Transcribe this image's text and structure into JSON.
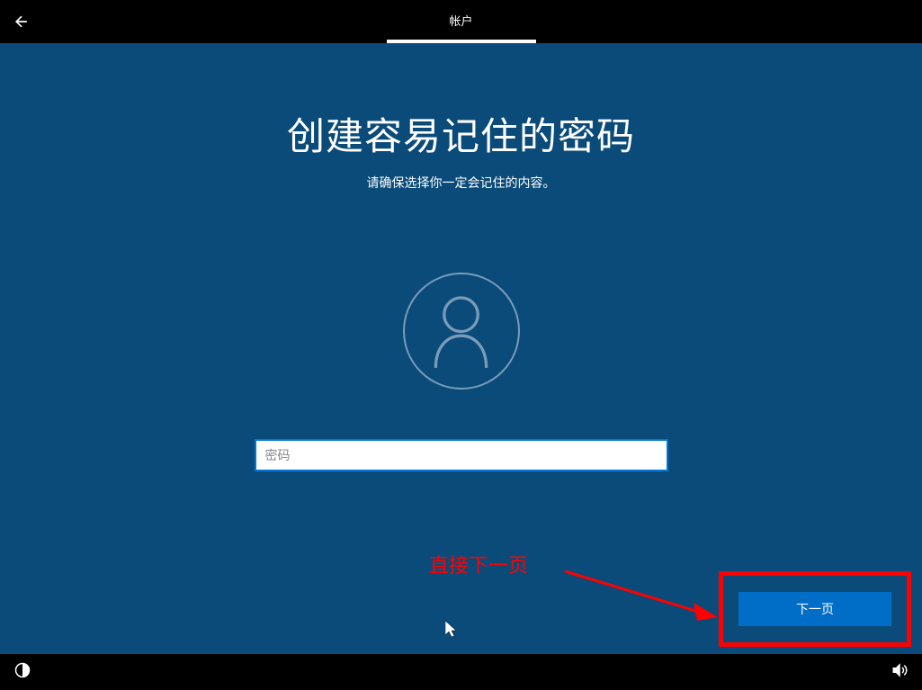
{
  "topbar": {
    "tab_label": "帐户"
  },
  "main": {
    "title": "创建容易记住的密码",
    "subtitle": "请确保选择你一定会记住的内容。",
    "password_placeholder": "密码"
  },
  "annotation": {
    "text": "直接下一页"
  },
  "footer": {
    "next_button": "下一页"
  }
}
